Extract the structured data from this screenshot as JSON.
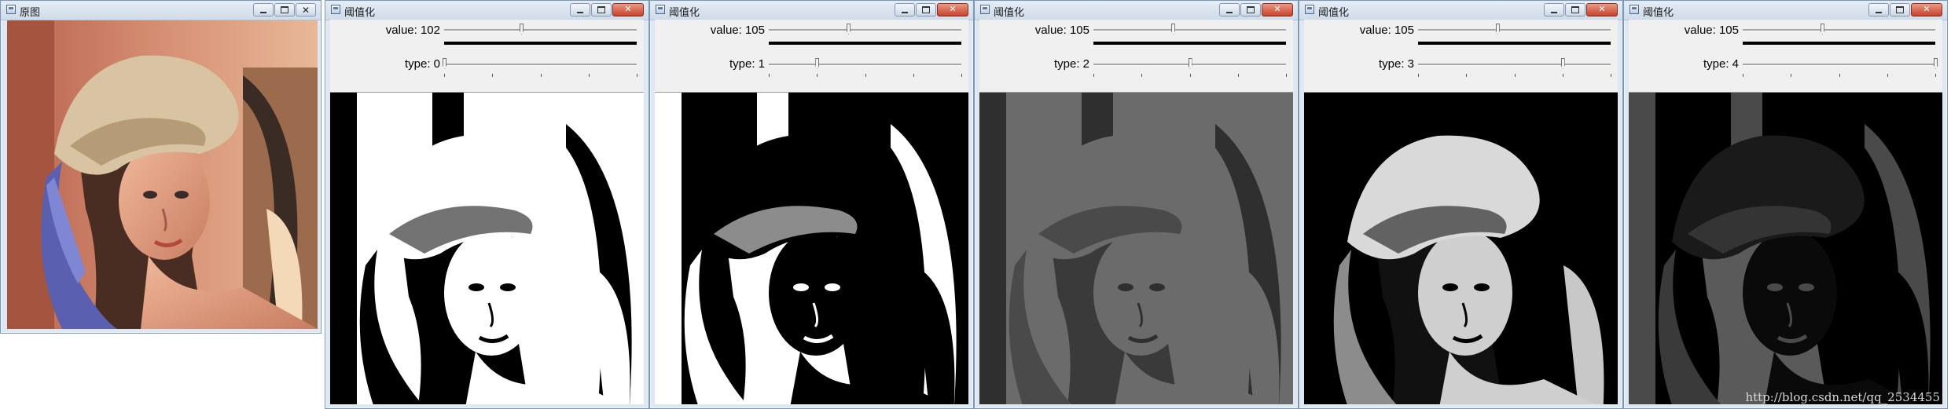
{
  "windows": [
    {
      "title": "原图",
      "kind": "original"
    },
    {
      "title": "阈值化",
      "kind": "threshold",
      "value_label": "value: 102",
      "type_label": "type: 0",
      "value": 102,
      "type": 0,
      "tone": "binary"
    },
    {
      "title": "阈值化",
      "kind": "threshold",
      "value_label": "value: 105",
      "type_label": "type: 1",
      "value": 105,
      "type": 1,
      "tone": "binary-inv"
    },
    {
      "title": "阈值化",
      "kind": "threshold",
      "value_label": "value: 105",
      "type_label": "type: 2",
      "value": 105,
      "type": 2,
      "tone": "trunc"
    },
    {
      "title": "阈值化",
      "kind": "threshold",
      "value_label": "value: 105",
      "type_label": "type: 3",
      "value": 105,
      "type": 3,
      "tone": "tozero"
    },
    {
      "title": "阈值化",
      "kind": "threshold",
      "value_label": "value: 105",
      "type_label": "type: 4",
      "value": 105,
      "type": 4,
      "tone": "tozero-inv"
    }
  ],
  "trackbars": {
    "value_max": 255,
    "type_max": 4
  },
  "watermark": "http://blog.csdn.net/qq_2534455",
  "colors": {
    "title_bg": "#d3dfeb",
    "close": "#c7412a"
  }
}
